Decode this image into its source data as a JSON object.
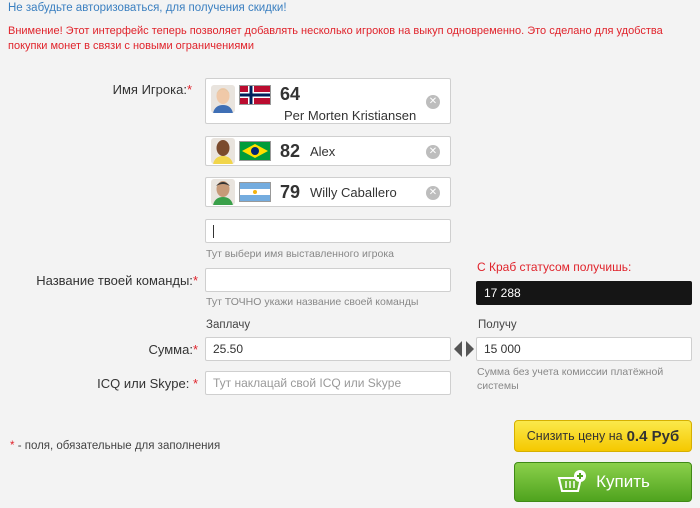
{
  "notices": {
    "login": "Не забудьте авторизоваться, для получения скидки!",
    "warning": "Внимение! Этот интерфейс теперь позволяет добавлять несколько игроков на выкуп одновременно. Это сделано для удобства покупки монет в связи с новыми ограничениями"
  },
  "form": {
    "player_label": "Имя Игрока:",
    "required_mark": "*",
    "players": [
      {
        "rating": "64",
        "name": "Per Morten Kristiansen",
        "flag": "norway"
      },
      {
        "rating": "82",
        "name": "Alex",
        "flag": "brazil"
      },
      {
        "rating": "79",
        "name": "Willy Caballero",
        "flag": "argentina"
      }
    ],
    "player_input_value": "",
    "player_hint": "Тут выбери имя выставленного игрока",
    "team_label": "Название твоей команды:",
    "team_input_value": "",
    "team_hint": "Тут ТОЧНО укажи название своей команды",
    "crab_title": "С Краб статусом получишь:",
    "crab_value": "17 288",
    "pay_label": "Заплачу",
    "get_label": "Получу",
    "sum_label": "Сумма:",
    "pay_value": "25.50",
    "get_value": "15 000",
    "get_hint": "Сумма без учета комиссии платёжной системы",
    "contact_label": "ICQ или Skype:",
    "contact_placeholder": "Тут наклацай свой ICQ или Skype",
    "required_note": "- поля, обязательные для заполнения"
  },
  "buttons": {
    "reduce_price_prefix": "Снизить цену на",
    "reduce_price_value": "0.4 Руб",
    "buy": "Купить"
  },
  "colors": {
    "accent_red": "#e0232b",
    "link_blue": "#3a7fc0",
    "buy_green": "#4fa31e",
    "reduce_yellow": "#f5c800"
  }
}
